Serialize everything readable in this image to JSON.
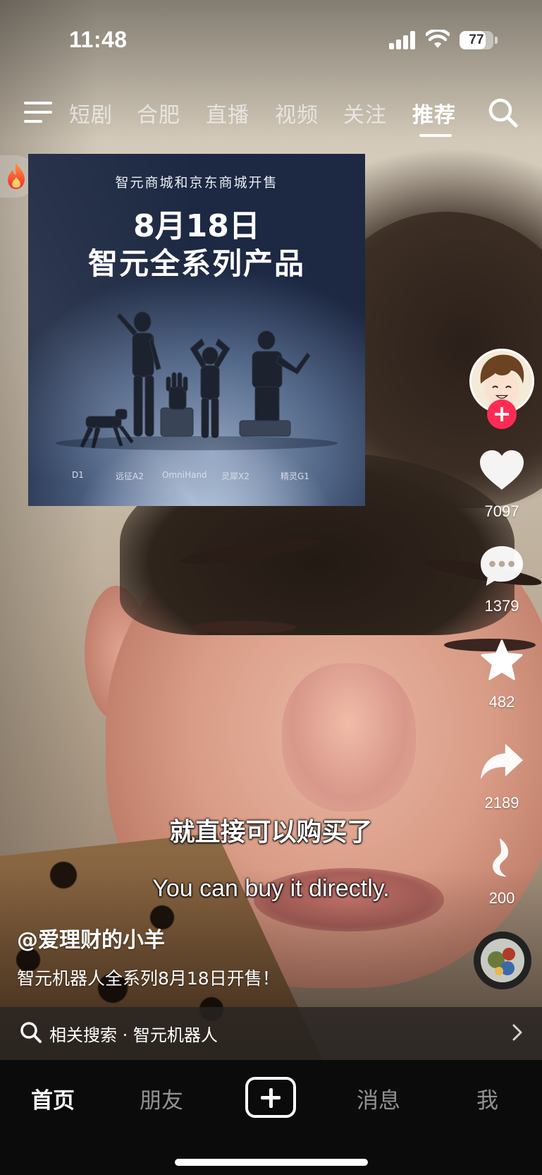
{
  "status_bar": {
    "time": "11:48",
    "battery": "77",
    "battery_level": 0.77
  },
  "top_nav": {
    "tabs": [
      {
        "label": "短剧",
        "active": false
      },
      {
        "label": "合肥",
        "active": false
      },
      {
        "label": "直播",
        "active": false
      },
      {
        "label": "视频",
        "active": false
      },
      {
        "label": "关注",
        "active": false
      },
      {
        "label": "推荐",
        "active": true
      }
    ],
    "menu_icon": "menu-icon",
    "search_icon": "search-icon"
  },
  "hot_badge": {
    "icon": "flame-icon"
  },
  "poster": {
    "subtitle": "智元商城和京东商城开售",
    "date": "8月18日",
    "title": "智元全系列产品",
    "robots": [
      "D1",
      "远征A2",
      "OmniHand",
      "灵犀X2",
      "精灵G1"
    ]
  },
  "actions": {
    "likes": "7097",
    "comments": "1379",
    "favorites": "482",
    "shares": "2189",
    "recommend": "200"
  },
  "captions": {
    "cn": "就直接可以购买了",
    "en": "You can buy it directly."
  },
  "post": {
    "author": "@爱理财的小羊",
    "description": "智元机器人全系列8月18日开售！"
  },
  "related_search": {
    "label": "相关搜索 · 智元机器人"
  },
  "bottom_nav": {
    "home": "首页",
    "friends": "朋友",
    "messages": "消息",
    "me": "我"
  },
  "colors": {
    "follow": "#fe2c55",
    "background": "#0b0b0b"
  }
}
